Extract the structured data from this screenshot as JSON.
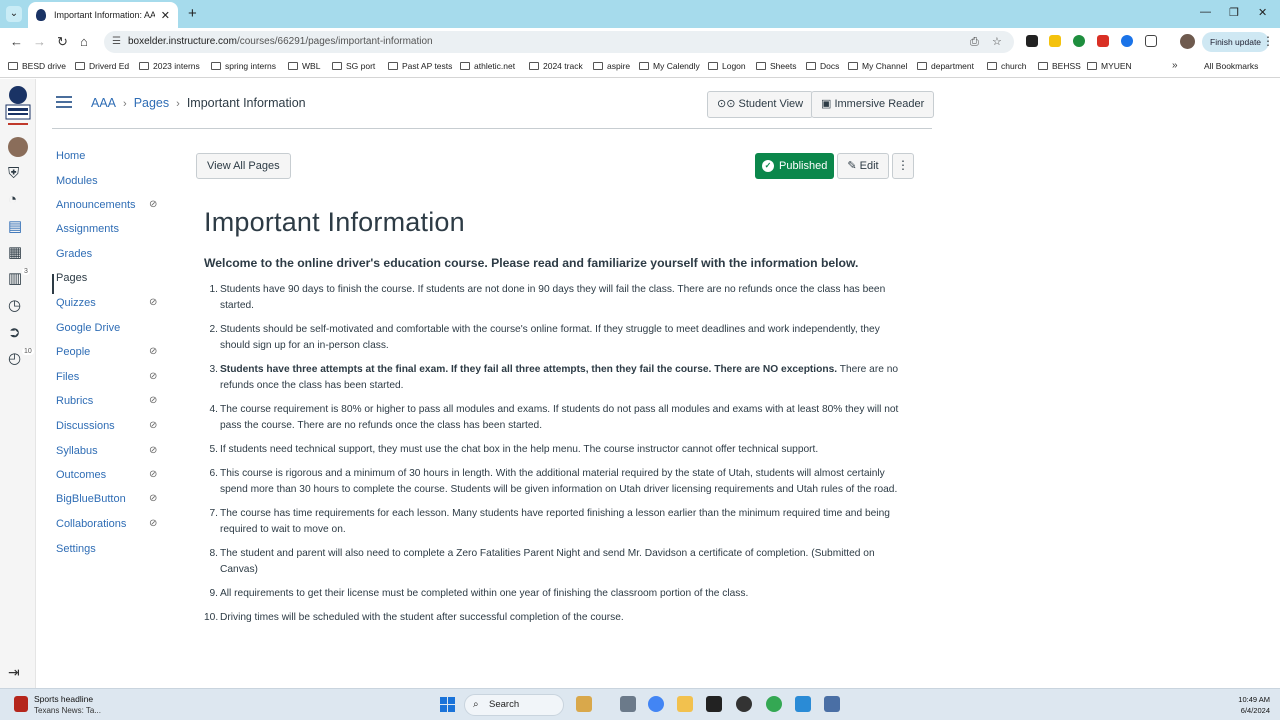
{
  "browser": {
    "tab_title": "Important Information: AAA C...",
    "url_host": "boxelder.instructure.com",
    "url_path": "/courses/66291/pages/important-information",
    "finish_update": "Finish update",
    "bookmarks": [
      "BESD drive",
      "Driverd Ed",
      "2023 interns",
      "spring interns",
      "WBL",
      "SG port",
      "Past AP tests",
      "athletic.net",
      "2024 track",
      "aspire",
      "My Calendly",
      "Logon",
      "Sheets",
      "Docs",
      "My Channel",
      "department",
      "church",
      "BEHSS",
      "MYUEN"
    ],
    "all_bookmarks": "All Bookmarks"
  },
  "global_nav": {
    "badges": {
      "inbox": "3",
      "history": "10"
    }
  },
  "breadcrumb": {
    "course": "AAA",
    "pages": "Pages",
    "current": "Important Information"
  },
  "header_buttons": {
    "student_view": "Student View",
    "immersive_reader": "Immersive Reader"
  },
  "course_nav": [
    {
      "label": "Home",
      "hidden": false
    },
    {
      "label": "Modules",
      "hidden": false
    },
    {
      "label": "Announcements",
      "hidden": true
    },
    {
      "label": "Assignments",
      "hidden": false
    },
    {
      "label": "Grades",
      "hidden": false
    },
    {
      "label": "Pages",
      "hidden": false,
      "active": true
    },
    {
      "label": "Quizzes",
      "hidden": true
    },
    {
      "label": "Google Drive",
      "hidden": false
    },
    {
      "label": "People",
      "hidden": true
    },
    {
      "label": "Files",
      "hidden": true
    },
    {
      "label": "Rubrics",
      "hidden": true
    },
    {
      "label": "Discussions",
      "hidden": true
    },
    {
      "label": "Syllabus",
      "hidden": true
    },
    {
      "label": "Outcomes",
      "hidden": true
    },
    {
      "label": "BigBlueButton",
      "hidden": true
    },
    {
      "label": "Collaborations",
      "hidden": true
    },
    {
      "label": "Settings",
      "hidden": false
    }
  ],
  "toolbar": {
    "view_all_pages": "View All Pages",
    "published": "Published",
    "edit": "Edit",
    "more": "⋮"
  },
  "page": {
    "title": "Important Information",
    "welcome": "Welcome to the online driver's education course. Please read and familiarize yourself with the information below.",
    "items": [
      {
        "n": "1",
        "text": "Students have 90 days to finish the course. If students are not done in 90 days they will fail the class. There are no refunds once the class has been started."
      },
      {
        "n": "2",
        "text": "Students should be self-motivated and comfortable with the course's online format. If they struggle to meet deadlines and work independently, they should sign up for an in-person class."
      },
      {
        "n": "3",
        "bold": "Students have three attempts at the final exam. If they fail all three attempts, then they fail the course. There are NO exceptions.",
        "text": " There are no refunds once the class has been started."
      },
      {
        "n": "4",
        "text": "The course requirement is 80% or higher to pass all modules and exams. If students do not pass all modules and exams with at least 80% they will not pass the course. There are no refunds once the class has been started."
      },
      {
        "n": "5",
        "text": "If students need technical support, they must use the chat box in the help menu. The course instructor cannot offer technical support."
      },
      {
        "n": "6",
        "text": "This course is rigorous and a minimum of 30 hours in length.  With the additional material required by the state of Utah, students will almost certainly spend more than 30 hours to complete the course. Students will be given information on Utah driver licensing requirements and Utah rules of the road."
      },
      {
        "n": "7",
        "text": "The course has time requirements for each lesson. Many students have reported finishing a lesson earlier than the minimum required time and being required to wait to move on."
      },
      {
        "n": "8",
        "text": "The student and parent will also need to complete a Zero Fatalities Parent Night and send Mr. Davidson a certificate of completion. (Submitted on Canvas)"
      },
      {
        "n": "9",
        "text": "All requirements to get their license must be completed within one year of finishing the classroom portion of the class."
      },
      {
        "n": "10",
        "text": "Driving times will be scheduled with the student after successful completion of the course."
      }
    ]
  },
  "taskbar": {
    "news_title": "Sports headline",
    "news_sub": "Texans News: Ta...",
    "search": "Search",
    "time": "10:49 AM",
    "date": "6/4/2024"
  },
  "colors": {
    "accent": "#2f6db5",
    "published": "#0b874b",
    "tabstrip": "#a6dbec"
  }
}
